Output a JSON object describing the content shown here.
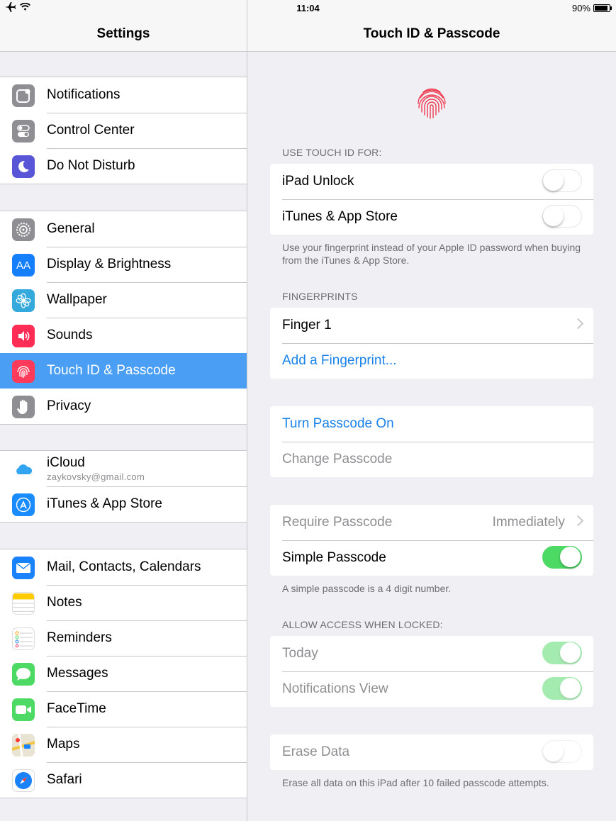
{
  "status_bar": {
    "time": "11:04",
    "battery": "90%",
    "battery_level": 0.9
  },
  "sidebar": {
    "title": "Settings",
    "groups": [
      [
        {
          "label": "Notifications",
          "icon": "notifications-icon",
          "color": "#8e8e93"
        },
        {
          "label": "Control Center",
          "icon": "control-center-icon",
          "color": "#8e8e93"
        },
        {
          "label": "Do Not Disturb",
          "icon": "moon-icon",
          "color": "#5856d6"
        }
      ],
      [
        {
          "label": "General",
          "icon": "gear-icon",
          "color": "#8e8e93"
        },
        {
          "label": "Display & Brightness",
          "icon": "display-icon",
          "color": "#147efb",
          "glyph": "AA"
        },
        {
          "label": "Wallpaper",
          "icon": "wallpaper-icon",
          "color": "#34aadc"
        },
        {
          "label": "Sounds",
          "icon": "speaker-icon",
          "color": "#ff2d55"
        },
        {
          "label": "Touch ID & Passcode",
          "icon": "fingerprint-icon",
          "color": "#ff3b5c",
          "selected": true
        },
        {
          "label": "Privacy",
          "icon": "hand-icon",
          "color": "#8e8e93"
        }
      ],
      [
        {
          "label": "iCloud",
          "sublabel": "zaykovsky@gmail.com",
          "icon": "icloud-icon",
          "color": "#ffffff"
        },
        {
          "label": "iTunes & App Store",
          "icon": "app-store-icon",
          "color": "#1a8cff"
        }
      ],
      [
        {
          "label": "Mail, Contacts, Calendars",
          "icon": "mail-icon",
          "color": "#1a82fb"
        },
        {
          "label": "Notes",
          "icon": "notes-icon",
          "color": "#ffcc00"
        },
        {
          "label": "Reminders",
          "icon": "reminders-icon",
          "color": "#ffffff"
        },
        {
          "label": "Messages",
          "icon": "messages-icon",
          "color": "#4cd964"
        },
        {
          "label": "FaceTime",
          "icon": "facetime-icon",
          "color": "#4cd964"
        },
        {
          "label": "Maps",
          "icon": "maps-icon",
          "color": "#e9e3d3"
        },
        {
          "label": "Safari",
          "icon": "safari-icon",
          "color": "#1a82fb"
        }
      ]
    ]
  },
  "detail": {
    "title": "Touch ID & Passcode",
    "touch_id_header": "USE TOUCH ID FOR:",
    "ipad_unlock": {
      "label": "iPad Unlock",
      "on": false
    },
    "itunes_store": {
      "label": "iTunes & App Store",
      "on": false
    },
    "touch_id_footer": "Use your fingerprint instead of your Apple ID password when buying from the iTunes & App Store.",
    "fingerprints_header": "FINGERPRINTS",
    "finger1": "Finger 1",
    "add_fingerprint": "Add a Fingerprint...",
    "turn_passcode_on": "Turn Passcode On",
    "change_passcode": "Change Passcode",
    "require_passcode": {
      "label": "Require Passcode",
      "value": "Immediately"
    },
    "simple_passcode": {
      "label": "Simple Passcode",
      "on": true
    },
    "simple_footer": "A simple passcode is a 4 digit number.",
    "allow_header": "ALLOW ACCESS WHEN LOCKED:",
    "today": {
      "label": "Today",
      "on": true
    },
    "notifications_view": {
      "label": "Notifications View",
      "on": true
    },
    "erase_data": {
      "label": "Erase Data",
      "on": false
    },
    "erase_footer": "Erase all data on this iPad after 10 failed passcode attempts."
  }
}
